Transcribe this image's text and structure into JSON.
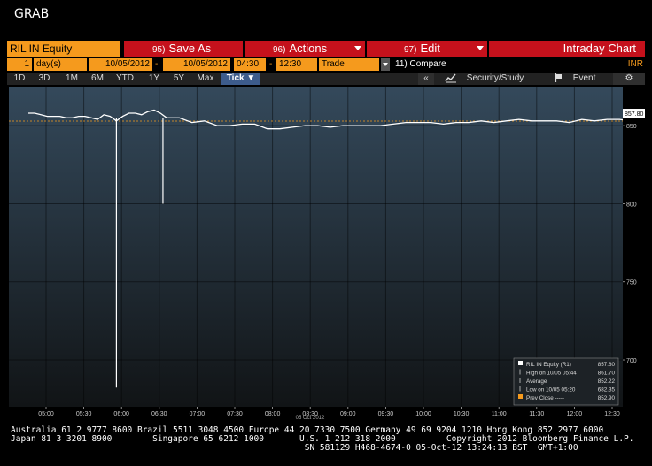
{
  "window": {
    "title": "GRAB"
  },
  "toolbar": {
    "ticker": "RIL IN Equity",
    "save_num": "95)",
    "save_label": "Save As",
    "actions_num": "96)",
    "actions_label": "Actions",
    "edit_num": "97)",
    "edit_label": "Edit",
    "chart_title": "Intraday Chart"
  },
  "params": {
    "interval_value": "1",
    "interval_unit": "day(s)",
    "start_date": "10/05/2012",
    "end_date": "10/05/2012",
    "start_time": "04:30",
    "end_time": "12:30",
    "event": "Trade",
    "compare": "11) Compare",
    "currency": "INR"
  },
  "periods": [
    "1D",
    "3D",
    "1M",
    "6M",
    "YTD",
    "1Y",
    "5Y",
    "Max",
    "Tick ▼"
  ],
  "active_period": "Tick ▼",
  "right_tools": {
    "collapse": "«",
    "study": "Security/Study",
    "event": "Event",
    "settings": "⚙"
  },
  "colors": {
    "orange": "#f59a1d",
    "red": "#c5111c",
    "active_blue": "#3d5c8c"
  },
  "chart_data": {
    "type": "line",
    "x_ticks": [
      "05:00",
      "05:30",
      "06:00",
      "06:30",
      "07:00",
      "07:30",
      "08:00",
      "08:30",
      "09:00",
      "09:30",
      "10:00",
      "10:30",
      "11:00",
      "11:30",
      "12:00",
      "12:30"
    ],
    "x_sub_label": "05 Oct 2012",
    "y_ticks": [
      700,
      750,
      800,
      850
    ],
    "ylim": [
      670,
      875
    ],
    "last_price_label": "857.80",
    "prev_close": 852.9,
    "series": [
      {
        "name": "RIL IN Equity (R1)",
        "x_minutes": [
          0,
          5,
          10,
          15,
          20,
          25,
          30,
          35,
          40,
          45,
          50,
          55,
          60,
          65,
          70,
          75,
          80,
          85,
          90,
          95,
          100,
          105,
          110,
          115,
          120,
          130,
          140,
          150,
          160,
          170,
          180,
          190,
          200,
          210,
          220,
          230,
          240,
          250,
          260,
          270,
          280,
          290,
          300,
          310,
          320,
          330,
          340,
          350,
          360,
          370,
          380,
          390,
          400,
          410,
          420,
          430,
          440,
          450,
          460,
          470,
          480,
          490,
          500,
          510,
          520,
          530,
          540,
          550,
          560,
          570,
          580,
          590,
          600,
          610,
          620,
          630,
          640,
          650,
          660,
          670,
          680,
          690,
          700,
          710,
          720
        ],
        "values": [
          858,
          858,
          857,
          856,
          856,
          856,
          855,
          855,
          856,
          856,
          855,
          854,
          857,
          856,
          853,
          856,
          858,
          858,
          857,
          859,
          860,
          858,
          855,
          855,
          855,
          852,
          853,
          850,
          850,
          851,
          851,
          848,
          848,
          849,
          850,
          850,
          849,
          850,
          850,
          850,
          850,
          851,
          852,
          852,
          852,
          851,
          852,
          852,
          853,
          852,
          853,
          854,
          853,
          853,
          853,
          852,
          854,
          853,
          854,
          854,
          853,
          855,
          855,
          855,
          856,
          856,
          855,
          856,
          857,
          857,
          857,
          858,
          858,
          858,
          858,
          858,
          858,
          858,
          858,
          858,
          858,
          858,
          858,
          858,
          858
        ]
      }
    ],
    "spikes": [
      {
        "x_minutes": 70,
        "low": 682.35
      },
      {
        "x_minutes": 107,
        "low": 800
      }
    ],
    "legend": {
      "position": "bottom-right",
      "rows": [
        {
          "label": "RIL IN Equity (R1)",
          "value": "857.80"
        },
        {
          "label": "High on 10/05 05:44",
          "value": "861.70"
        },
        {
          "label": "Average",
          "value": "852.22"
        },
        {
          "label": "Low on 10/05 05:20",
          "value": "682.35"
        },
        {
          "label": "Prev Close -----",
          "value": "852.90"
        }
      ]
    }
  },
  "footer": {
    "line1": "Australia 61 2 9777 8600 Brazil 5511 3048 4500 Europe 44 20 7330 7500 Germany 49 69 9204 1210 Hong Kong 852 2977 6000",
    "line2": "Japan 81 3 3201 8900        Singapore 65 6212 1000       U.S. 1 212 318 2000          Copyright 2012 Bloomberg Finance L.P.",
    "line3": "                                                          SN 581129 H468-4674-0 05-Oct-12 13:24:13 BST  GMT+1:00"
  }
}
